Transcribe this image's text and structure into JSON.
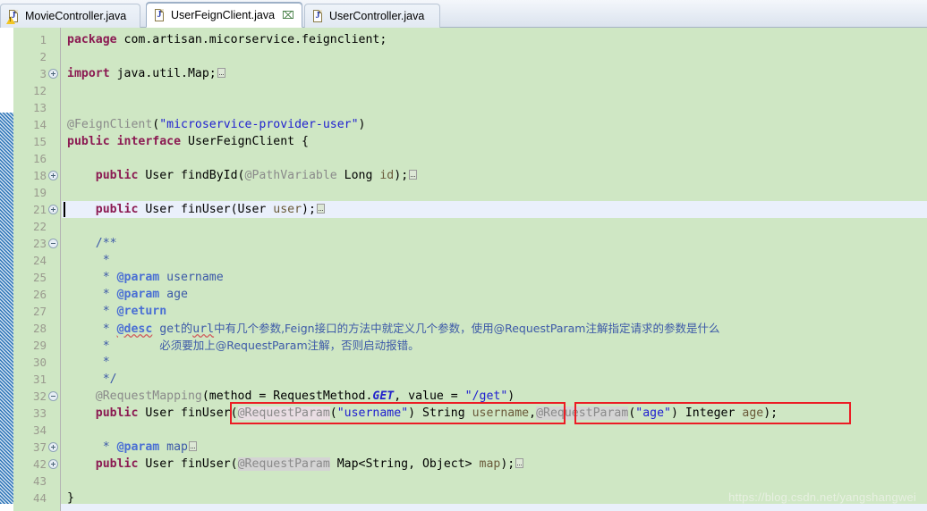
{
  "window": {
    "app": "Eclipse IDE Java Editor",
    "colors": {
      "editor_background": "#cfe7c4",
      "current_line": "#eaf0fb",
      "gutter_text": "#9a9a8e",
      "keyword": "#8b1a52",
      "string": "#2020d0",
      "comment": "#3d5aa8",
      "annotation": "#8a8a8a",
      "highlight_box": "#ec1c24",
      "change_bar": "#2e75b6"
    }
  },
  "tabs": [
    {
      "label": "MovieController.java",
      "icon": "java-file-warning-icon",
      "active": false,
      "closable": false
    },
    {
      "label": "UserFeignClient.java",
      "icon": "java-file-icon",
      "active": true,
      "closable": true,
      "close_glyph": "⌧"
    },
    {
      "label": "UserController.java",
      "icon": "java-file-icon",
      "active": false,
      "closable": false
    }
  ],
  "editor": {
    "file": "UserFeignClient.java",
    "current_line": 21,
    "lines": [
      {
        "n": "1",
        "fold": "none",
        "current": false
      },
      {
        "n": "2",
        "fold": "none",
        "current": false
      },
      {
        "n": "3",
        "fold": "plus",
        "current": false
      },
      {
        "n": "12",
        "fold": "none",
        "current": false
      },
      {
        "n": "13",
        "fold": "none",
        "current": false
      },
      {
        "n": "14",
        "fold": "none",
        "current": false
      },
      {
        "n": "15",
        "fold": "none",
        "current": false
      },
      {
        "n": "16",
        "fold": "none",
        "current": false
      },
      {
        "n": "18",
        "fold": "plus",
        "current": false
      },
      {
        "n": "19",
        "fold": "none",
        "current": false
      },
      {
        "n": "21",
        "fold": "plus",
        "current": true
      },
      {
        "n": "22",
        "fold": "none",
        "current": false
      },
      {
        "n": "23",
        "fold": "minus",
        "current": false
      },
      {
        "n": "24",
        "fold": "none",
        "current": false
      },
      {
        "n": "25",
        "fold": "none",
        "current": false
      },
      {
        "n": "26",
        "fold": "none",
        "current": false
      },
      {
        "n": "27",
        "fold": "none",
        "current": false
      },
      {
        "n": "28",
        "fold": "none",
        "current": false
      },
      {
        "n": "29",
        "fold": "none",
        "current": false
      },
      {
        "n": "30",
        "fold": "none",
        "current": false
      },
      {
        "n": "31",
        "fold": "none",
        "current": false
      },
      {
        "n": "32",
        "fold": "minus",
        "current": false
      },
      {
        "n": "33",
        "fold": "none",
        "current": false
      },
      {
        "n": "34",
        "fold": "none",
        "current": false
      },
      {
        "n": "37",
        "fold": "plus",
        "current": false
      },
      {
        "n": "42",
        "fold": "plus",
        "current": false
      },
      {
        "n": "43",
        "fold": "none",
        "current": false
      },
      {
        "n": "44",
        "fold": "none",
        "current": false
      }
    ],
    "source_text": [
      "package com.artisan.micorservice.feignclient;",
      "",
      "import java.util.Map;",
      "",
      "",
      "@FeignClient(\"microservice-provider-user\")",
      "public interface UserFeignClient {",
      "",
      "    public User findById(@PathVariable Long id);",
      "",
      "    public User finUser(User user);",
      "",
      "    /**",
      "     *",
      "     * @param username",
      "     * @param age",
      "     * @return",
      "     * @desc get的url中有几个参数,Feign接口的方法中就定义几个参数，使用@RequestParam注解指定请求的参数是什么",
      "     *       必须要加上@RequestParam注解，否则启动报错。",
      "     *",
      "     */",
      "    @RequestMapping(method = RequestMethod.GET, value = \"/get\")",
      "    public User finUser(@RequestParam(\"username\") String username,@RequestParam(\"age\") Integer age);",
      "",
      "     * @param map",
      "    public User finUser(@RequestParam Map<String, Object> map);",
      "",
      "}"
    ],
    "annotations": {
      "red_boxes": [
        {
          "label": "username-param-highlight",
          "around": "@RequestParam(\"username\") String username"
        },
        {
          "label": "age-param-highlight",
          "around": "@RequestParam(\"age\") Integer age)"
        }
      ],
      "occurrence_highlight": "@RequestParam"
    }
  },
  "watermark": "https://blog.csdn.net/yangshangwei"
}
